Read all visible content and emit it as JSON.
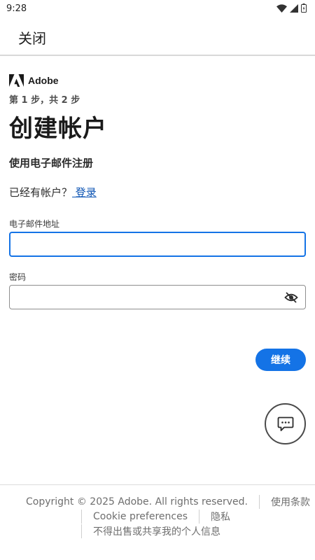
{
  "status_bar": {
    "time": "9:28",
    "icons": [
      "wifi-icon",
      "signal-icon",
      "battery-icon"
    ]
  },
  "top_bar": {
    "close_label": "关闭"
  },
  "brand": {
    "name": "Adobe",
    "logo_icon": "adobe-logo-icon"
  },
  "form": {
    "step": "第 1 步，共 2 步",
    "title": "创建帐户",
    "subtitle": "使用电子邮件注册",
    "have_account_text": "已经有帐户？",
    "signin_link": " 登录",
    "email_label": "电子邮件地址",
    "email_value": "",
    "password_label": "密码",
    "password_value": "",
    "password_toggle_icon": "eye-off-icon",
    "continue_label": "继续"
  },
  "chat": {
    "icon": "chat-bubble-icon"
  },
  "footer": {
    "copyright": "Copyright © 2025 Adobe. All rights reserved.",
    "terms": "使用条款",
    "cookie": "Cookie preferences",
    "privacy": "隐私",
    "do_not_sell": "不得出售或共享我的个人信息"
  },
  "colors": {
    "accent": "#1473e6",
    "link": "#0b53b3",
    "text": "#2c2c2c"
  }
}
